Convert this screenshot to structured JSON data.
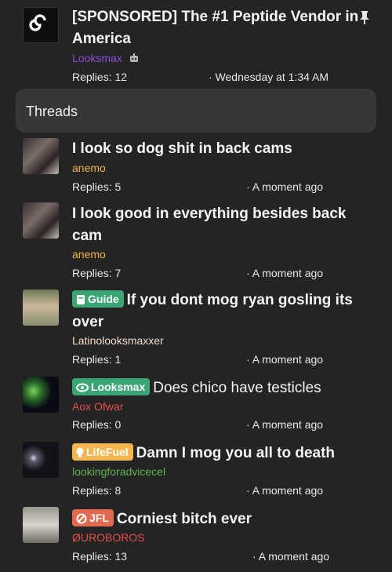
{
  "sponsored": {
    "title": "[SPONSORED] The #1 Peptide Vendor in America",
    "forum": "Looksmax",
    "replies": "Replies: 12",
    "time": "· Wednesday at 1:34 AM"
  },
  "section": {
    "label": "Threads"
  },
  "threads": [
    {
      "title": "I look so dog shit in back cams",
      "author": "anemo",
      "author_color": "#f0b34a",
      "replies": "Replies: 5",
      "time": "· A moment ago"
    },
    {
      "title": "I look good in everything besides back cam",
      "author": "anemo",
      "author_color": "#f0b34a",
      "replies": "Replies: 7",
      "time": "· A moment ago"
    },
    {
      "prefix": "Guide",
      "prefix_color": "#3aa675",
      "title": "If you dont mog ryan gosling its over",
      "author": "Latinolooksmaxxer",
      "author_color": "#f6dcc8",
      "replies": "Replies: 1",
      "time": "· A moment ago"
    },
    {
      "prefix": "Looksmax",
      "prefix_color": "#3aa675",
      "title": "Does chico have testicles",
      "author": "Aox Ofwar",
      "author_color": "#e0514a",
      "replies": "Replies: 0",
      "time": "· A moment ago"
    },
    {
      "prefix": "LifeFuel",
      "prefix_color": "#f4b64e",
      "title": "Damn I mog you all to death",
      "author": "lookingforadvicecel",
      "author_color": "#5fb34f",
      "replies": "Replies: 8",
      "time": "· A moment ago"
    },
    {
      "prefix": "JFL",
      "prefix_color": "#e0694f",
      "title": "Corniest bitch ever",
      "author": "ØUROBOROS",
      "author_color": "#e0514a",
      "replies": "Replies: 13",
      "time": "· A moment ago"
    }
  ]
}
